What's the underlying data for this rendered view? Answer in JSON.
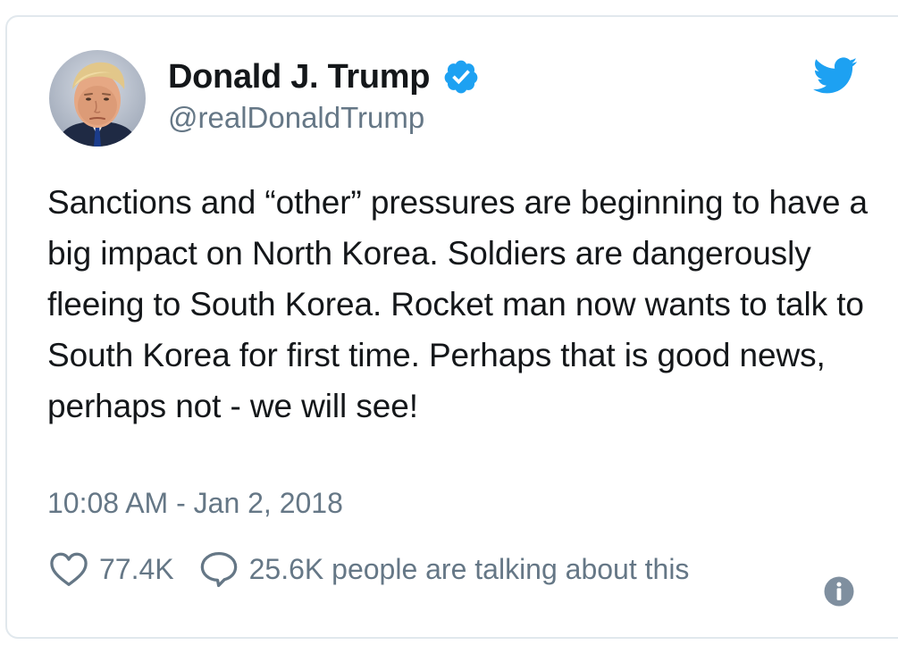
{
  "tweet": {
    "author_name": "Donald J. Trump",
    "handle": "@realDonaldTrump",
    "text": "Sanctions and “other” pressures are beginning to have a big impact on North Korea. Soldiers are dangerously fleeing to South Korea. Rocket man now wants to talk to South Korea for first time. Perhaps that is good news, perhaps not - we will see!",
    "timestamp": "10:08 AM - Jan 2, 2018",
    "likes": "77.4K",
    "talking": "25.6K people are talking about this"
  },
  "icons": {
    "verified": "verified-badge-icon",
    "brand": "twitter-bird-icon",
    "like": "heart-icon",
    "reply": "speech-bubble-icon",
    "info": "info-icon"
  },
  "colors": {
    "brand_blue": "#1da1f2",
    "text": "#14171a",
    "secondary_text": "#657786",
    "border": "#e1e8ed"
  }
}
